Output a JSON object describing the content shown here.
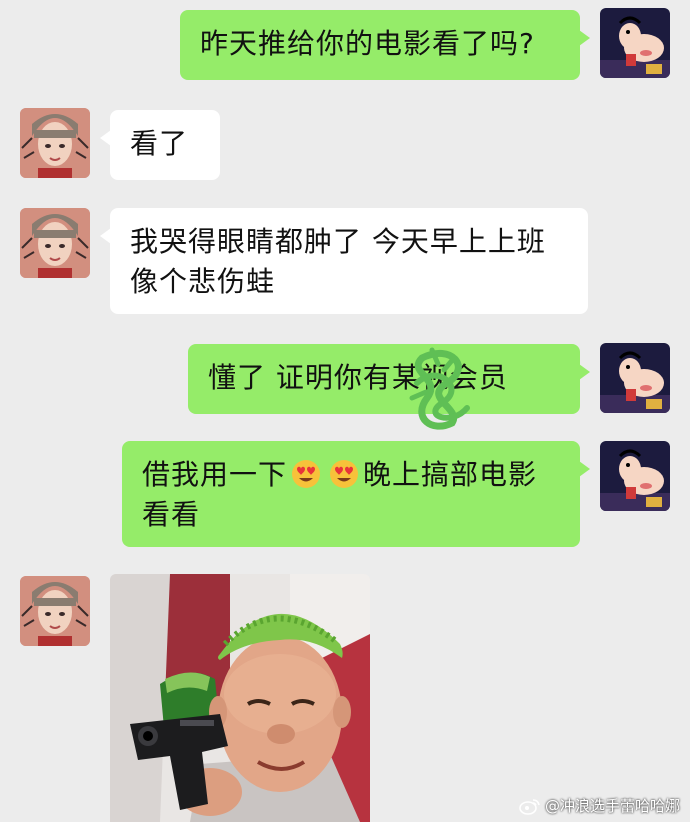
{
  "messages": {
    "m1": {
      "sender": "me",
      "text": "昨天推给你的电影看了吗?"
    },
    "m2": {
      "sender": "friend",
      "text": "看了"
    },
    "m3": {
      "sender": "friend",
      "line1": "我哭得眼睛都肿了 今天早上上班",
      "line2": "像个悲伤蛙"
    },
    "m4": {
      "sender": "me",
      "text": "懂了 证明你有某视会员"
    },
    "m5": {
      "sender": "me",
      "part1": "借我用一下",
      "emoji": "heart-eyes-emoji",
      "part2": "晚上搞部电影",
      "line2": "看看"
    },
    "m6": {
      "sender": "friend",
      "type": "image",
      "image": "green-hair-man-with-gun-meme"
    }
  },
  "watermark": {
    "icon": "weibo-icon",
    "text": "@冲浪选手蕾哈哈娜"
  },
  "colors": {
    "background": "#ececec",
    "outgoing_bubble": "#95ec69",
    "incoming_bubble": "#ffffff",
    "scribble": "#5fbf55"
  }
}
